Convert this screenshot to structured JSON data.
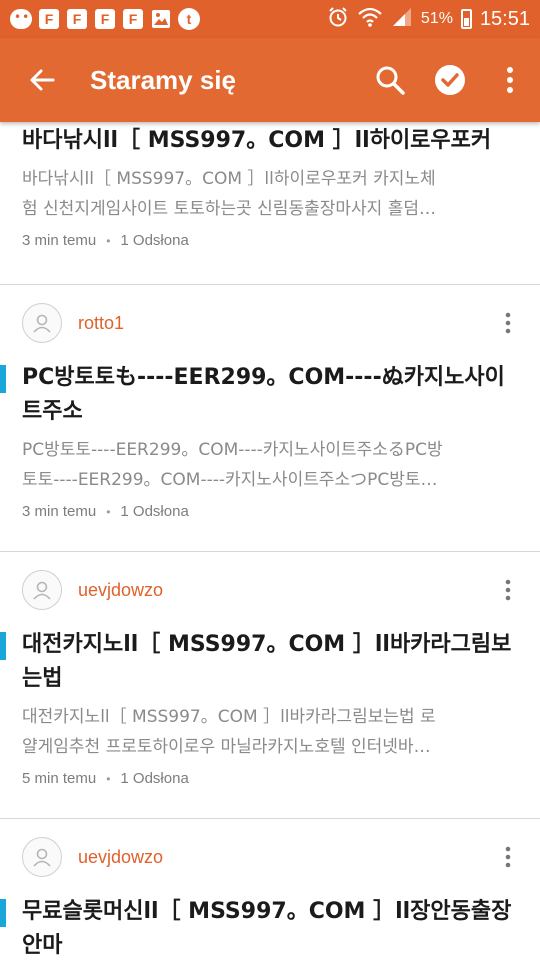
{
  "status_bar": {
    "battery_percent": "51%",
    "time": "15:51",
    "icons": [
      "chat-bubble-icon",
      "flipboard-icon",
      "flipboard-icon",
      "flipboard-icon",
      "flipboard-icon",
      "image-icon",
      "tumblr-icon",
      "alarm-icon",
      "wifi-icon",
      "signal-icon",
      "battery-icon"
    ]
  },
  "app_bar": {
    "title": "Staramy się",
    "icons": [
      "back-arrow-icon",
      "search-icon",
      "check-circle-icon",
      "more-vert-icon"
    ]
  },
  "colors": {
    "accent": "#e0612b",
    "highlight_bar": "#1aa6d9",
    "meta_text": "#7d7d7d",
    "snippet_text": "#8a8a8a"
  },
  "posts": [
    {
      "title": "바다낚시ll［ MSS997。COM ］ll하이로우포커",
      "snippet_l1": "바다낚시ll［ MSS997。COM ］ll하이로우포커 카지노체",
      "snippet_l2": "험 신천지게임사이트 토토하는곳 신림동출장마사지 홀덤…",
      "time": "3 min temu",
      "views": "1 Odsłona"
    },
    {
      "author": "rotto1",
      "title": "PC방토토も----EER299。COM----ぬ카지노사이트주소",
      "snippet_l1": "PC방토토----EER299。COM----카지노사이트주소るPC방",
      "snippet_l2": "토토----EER299。COM----카지노사이트주소つPC방토…",
      "time": "3 min temu",
      "views": "1 Odsłona"
    },
    {
      "author": "uevjdowzo",
      "title": "대전카지노ll［ MSS997。COM ］ll바카라그림보는법",
      "snippet_l1": "대전카지노ll［ MSS997。COM ］ll바카라그림보는법 로",
      "snippet_l2": "얄게임추천 프로토하이로우 마닐라카지노호텔 인터넷바…",
      "time": "5 min temu",
      "views": "1 Odsłona"
    },
    {
      "author": "uevjdowzo",
      "title": "무료슬롯머신ll［ MSS997。COM ］ll장안동출장안마"
    }
  ]
}
